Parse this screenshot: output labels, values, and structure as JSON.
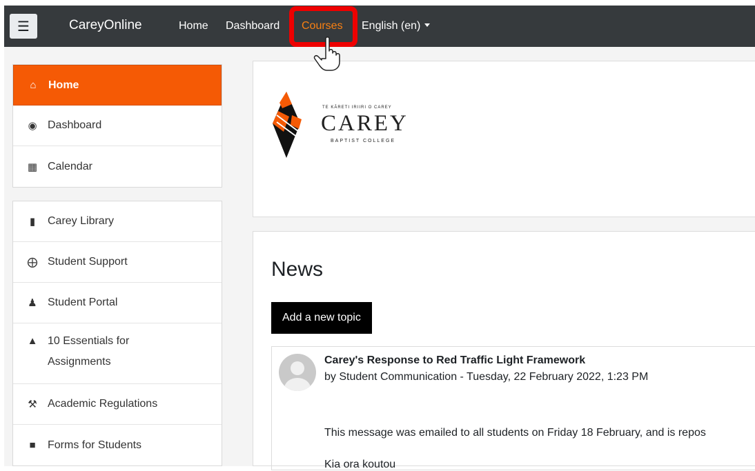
{
  "navbar": {
    "brand": "CareyOnline",
    "links": [
      "Home",
      "Dashboard",
      "Courses",
      "English (en)"
    ],
    "active_link": "Courses",
    "accent_color": "#f98012",
    "highlight_color": "#ee0000"
  },
  "sidebar": {
    "primary": [
      {
        "label": "Home",
        "icon": "home-icon",
        "active": true
      },
      {
        "label": "Dashboard",
        "icon": "dashboard-icon"
      },
      {
        "label": "Calendar",
        "icon": "calendar-icon"
      }
    ],
    "secondary": [
      {
        "label": "Carey Library",
        "icon": "book-icon"
      },
      {
        "label": "Student Support",
        "icon": "life-ring-icon"
      },
      {
        "label": "Student Portal",
        "icon": "user-plus-icon"
      },
      {
        "label": "10 Essentials for Assignments",
        "icon": "graduation-cap-icon"
      },
      {
        "label": "Academic Regulations",
        "icon": "gavel-icon"
      },
      {
        "label": "Forms for Students",
        "icon": "folder-open-icon"
      }
    ],
    "active_color": "#f55a05"
  },
  "logo": {
    "tagline": "TE KĀRETI IRIIRI O CAREY",
    "name": "CAREY",
    "subtitle": "BAPTIST COLLEGE"
  },
  "news": {
    "title": "News",
    "add_button": "Add a new topic",
    "post": {
      "title": "Carey's Response to Red Traffic Light Framework",
      "byline": "by Student Communication - Tuesday, 22 February 2022, 1:23 PM",
      "body": "This message was emailed to all students on Friday 18 February, and is repos",
      "signoff": "Kia ora koutou"
    }
  }
}
